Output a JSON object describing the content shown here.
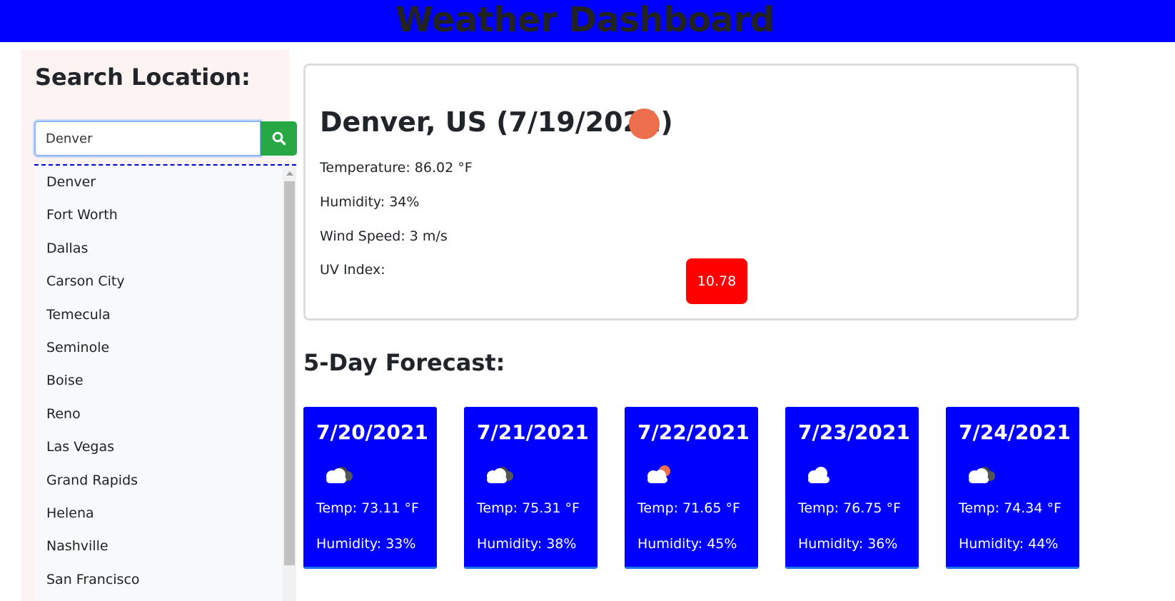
{
  "header": {
    "title": "Weather Dashboard"
  },
  "sidebar": {
    "title": "Search Location:",
    "search": {
      "value": "Denver",
      "button_icon": "search-icon"
    },
    "suggestions": [
      "Denver",
      "Fort Worth",
      "Dallas",
      "Carson City",
      "Temecula",
      "Seminole",
      "Boise",
      "Reno",
      "Las Vegas",
      "Grand Rapids",
      "Helena",
      "Nashville",
      "San Francisco"
    ]
  },
  "current": {
    "title": "Denver, US (7/19/2021)",
    "icon": "clear-sky-sun-icon",
    "temperature": "Temperature: 86.02 °F",
    "humidity": "Humidity: 34%",
    "wind": "Wind Speed: 3 m/s",
    "uv_label": "UV Index:",
    "uv_value": "10.78",
    "uv_color": "#ff0000"
  },
  "forecast": {
    "title": "5-Day Forecast:",
    "days": [
      {
        "date": "7/20/2021",
        "icon": "broken-clouds-icon",
        "temp": "Temp: 73.11 °F",
        "humidity": "Humidity: 33%"
      },
      {
        "date": "7/21/2021",
        "icon": "broken-clouds-icon",
        "temp": "Temp: 75.31 °F",
        "humidity": "Humidity: 38%"
      },
      {
        "date": "7/22/2021",
        "icon": "few-clouds-icon",
        "temp": "Temp: 71.65 °F",
        "humidity": "Humidity: 45%"
      },
      {
        "date": "7/23/2021",
        "icon": "scattered-clouds-icon",
        "temp": "Temp: 76.75 °F",
        "humidity": "Humidity: 36%"
      },
      {
        "date": "7/24/2021",
        "icon": "broken-clouds-icon",
        "temp": "Temp: 74.34 °F",
        "humidity": "Humidity: 44%"
      }
    ],
    "card_color": "#0000ff"
  },
  "colors": {
    "header_bg": "#0000ff",
    "search_button": "#28a745",
    "sun": "#ec6e4c"
  }
}
